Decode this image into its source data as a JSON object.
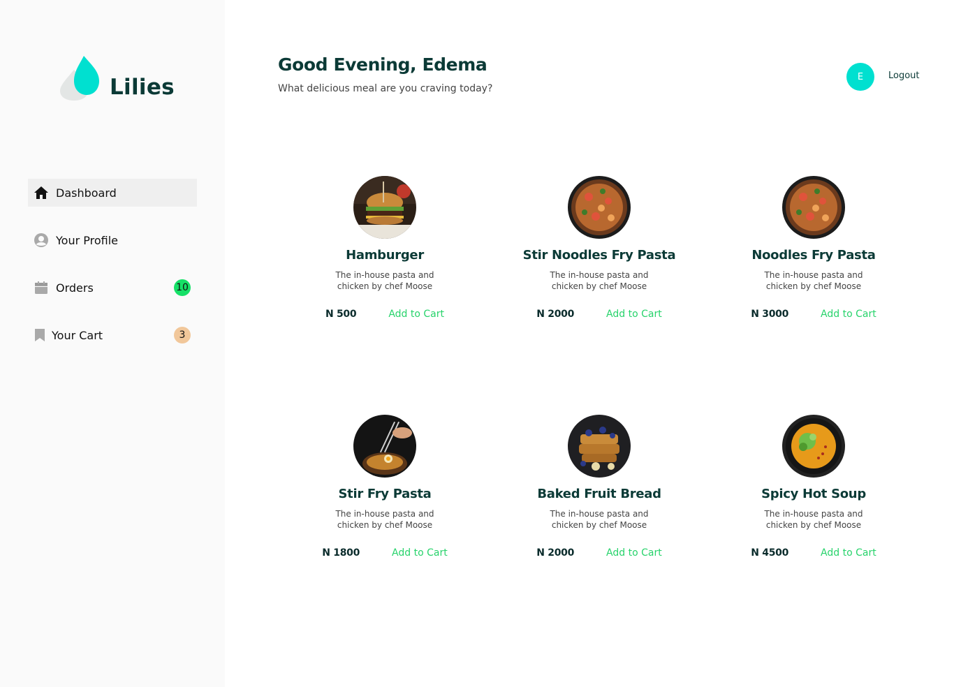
{
  "brand": {
    "name": "Lilies",
    "accent": "#00e0d0"
  },
  "header": {
    "greeting": "Good Evening, Edema",
    "subtitle": "What delicious meal are you craving today?",
    "avatar_initial": "E",
    "logout_label": "Logout"
  },
  "sidebar": {
    "items": [
      {
        "label": "Dashboard",
        "icon": "home-icon",
        "active": true
      },
      {
        "label": "Your Profile",
        "icon": "profile-icon"
      },
      {
        "label": "Orders",
        "icon": "calendar-icon",
        "badge": "10",
        "badge_color": "#16e067"
      },
      {
        "label": "Your Cart",
        "icon": "bookmark-icon",
        "badge": "3",
        "badge_color": "#f1c79a"
      }
    ]
  },
  "menu": [
    {
      "name": "Hamburger",
      "description": "The in-house pasta and chicken by chef Moose",
      "price": "N 500",
      "cta": "Add to Cart"
    },
    {
      "name": "Stir Noodles Fry Pasta",
      "description": "The in-house pasta and chicken by chef Moose",
      "price": "N 2000",
      "cta": "Add to Cart"
    },
    {
      "name": "Noodles Fry Pasta",
      "description": "The in-house pasta and chicken by chef Moose",
      "price": "N 3000",
      "cta": "Add to Cart"
    },
    {
      "name": "Stir Fry Pasta",
      "description": "The in-house pasta and chicken by chef Moose",
      "price": "N 1800",
      "cta": "Add to Cart"
    },
    {
      "name": "Baked Fruit Bread",
      "description": "The in-house pasta and chicken by chef Moose",
      "price": "N 2000",
      "cta": "Add to Cart"
    },
    {
      "name": "Spicy Hot Soup",
      "description": "The in-house pasta and chicken by chef Moose",
      "price": "N 4500",
      "cta": "Add to Cart"
    }
  ]
}
